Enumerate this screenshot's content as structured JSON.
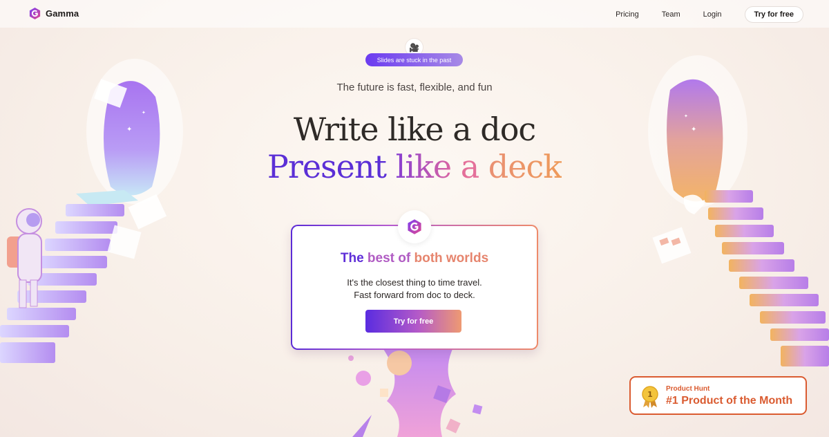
{
  "nav": {
    "brand": "Gamma",
    "links": [
      "Pricing",
      "Team",
      "Login"
    ],
    "cta": "Try for free"
  },
  "hero": {
    "pill_icon": "film-camera-icon",
    "badge": "Slides are stuck in the past",
    "tagline": "The future is fast, flexible, and fun",
    "headline_line1": "Write like a doc",
    "headline_line2": {
      "present": "Present",
      "like": " like",
      "a": " a",
      "deck": " deck"
    }
  },
  "card": {
    "title": {
      "part1": "The ",
      "part2": "best of ",
      "part3": "both worlds"
    },
    "line1": "It's the closest thing to time travel.",
    "line2": "Fast forward from doc to deck.",
    "button": "Try for free"
  },
  "product_hunt": {
    "label": "Product Hunt",
    "title": "#1 Product of the Month",
    "medal_number": "1"
  },
  "colors": {
    "accent_purple": "#5b2fd6",
    "accent_orange": "#da5b30"
  }
}
